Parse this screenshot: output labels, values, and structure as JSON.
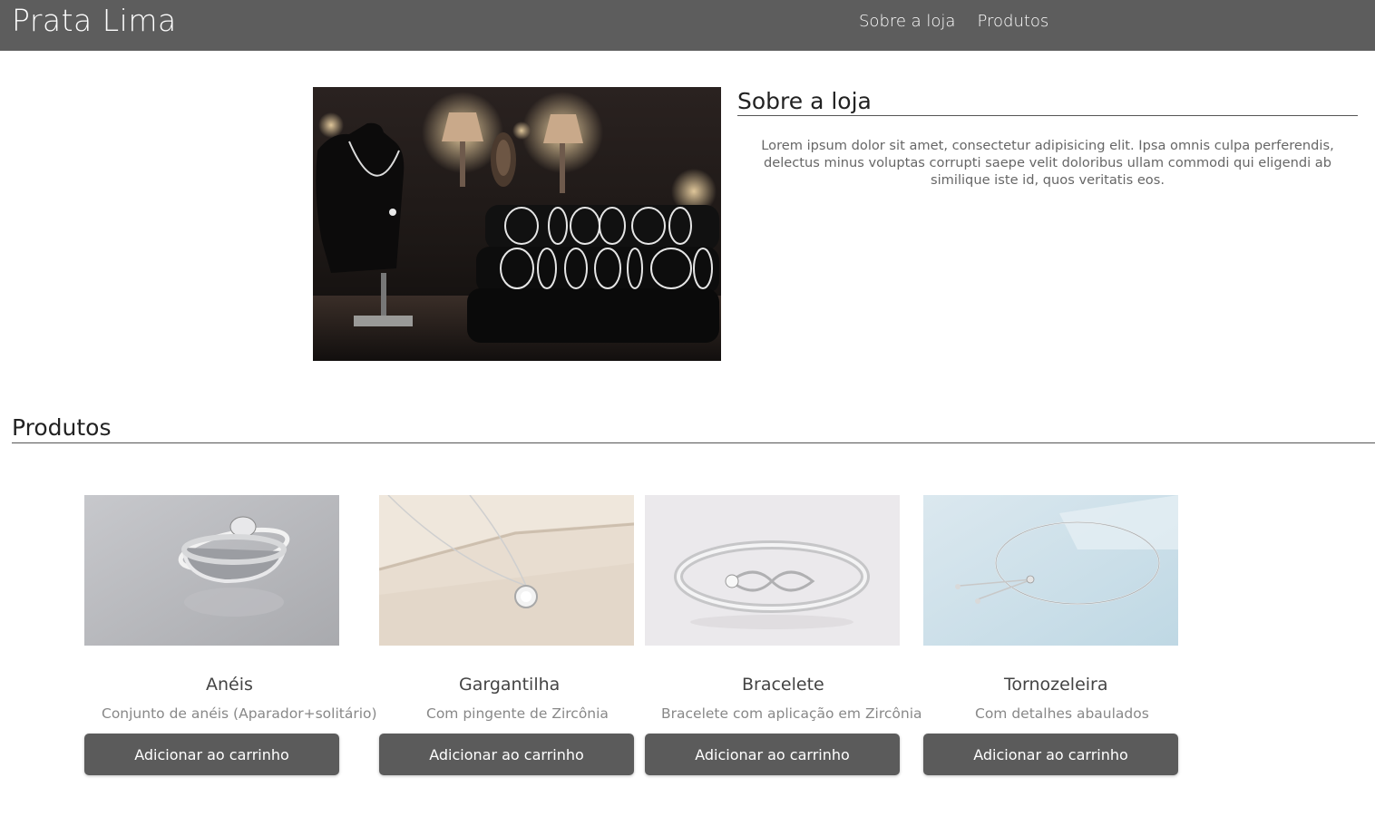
{
  "header": {
    "brand": "Prata Lima",
    "nav": [
      {
        "label": "Sobre a loja"
      },
      {
        "label": "Produtos"
      }
    ]
  },
  "about": {
    "title": "Sobre a loja",
    "text": "Lorem ipsum dolor sit amet, consectetur adipisicing elit. Ipsa omnis culpa perferendis, delectus minus voluptas corrupti saepe velit doloribus ullam commodi qui eligendi ab similique iste id, quos veritatis eos."
  },
  "products": {
    "title": "Produtos",
    "items": [
      {
        "name": "Anéis",
        "description": "Conjunto de anéis (Aparador+solitário)",
        "button": "Adicionar ao carrinho"
      },
      {
        "name": "Gargantilha",
        "description": "Com pingente de Zircônia",
        "button": "Adicionar ao carrinho"
      },
      {
        "name": "Bracelete",
        "description": "Bracelete com aplicação em Zircônia",
        "button": "Adicionar ao carrinho"
      },
      {
        "name": "Tornozeleira",
        "description": "Com detalhes abaulados",
        "button": "Adicionar ao carrinho"
      }
    ]
  },
  "colors": {
    "header_bg": "#5d5d5d",
    "button_bg": "#5b5b5b",
    "rule": "#555555"
  }
}
